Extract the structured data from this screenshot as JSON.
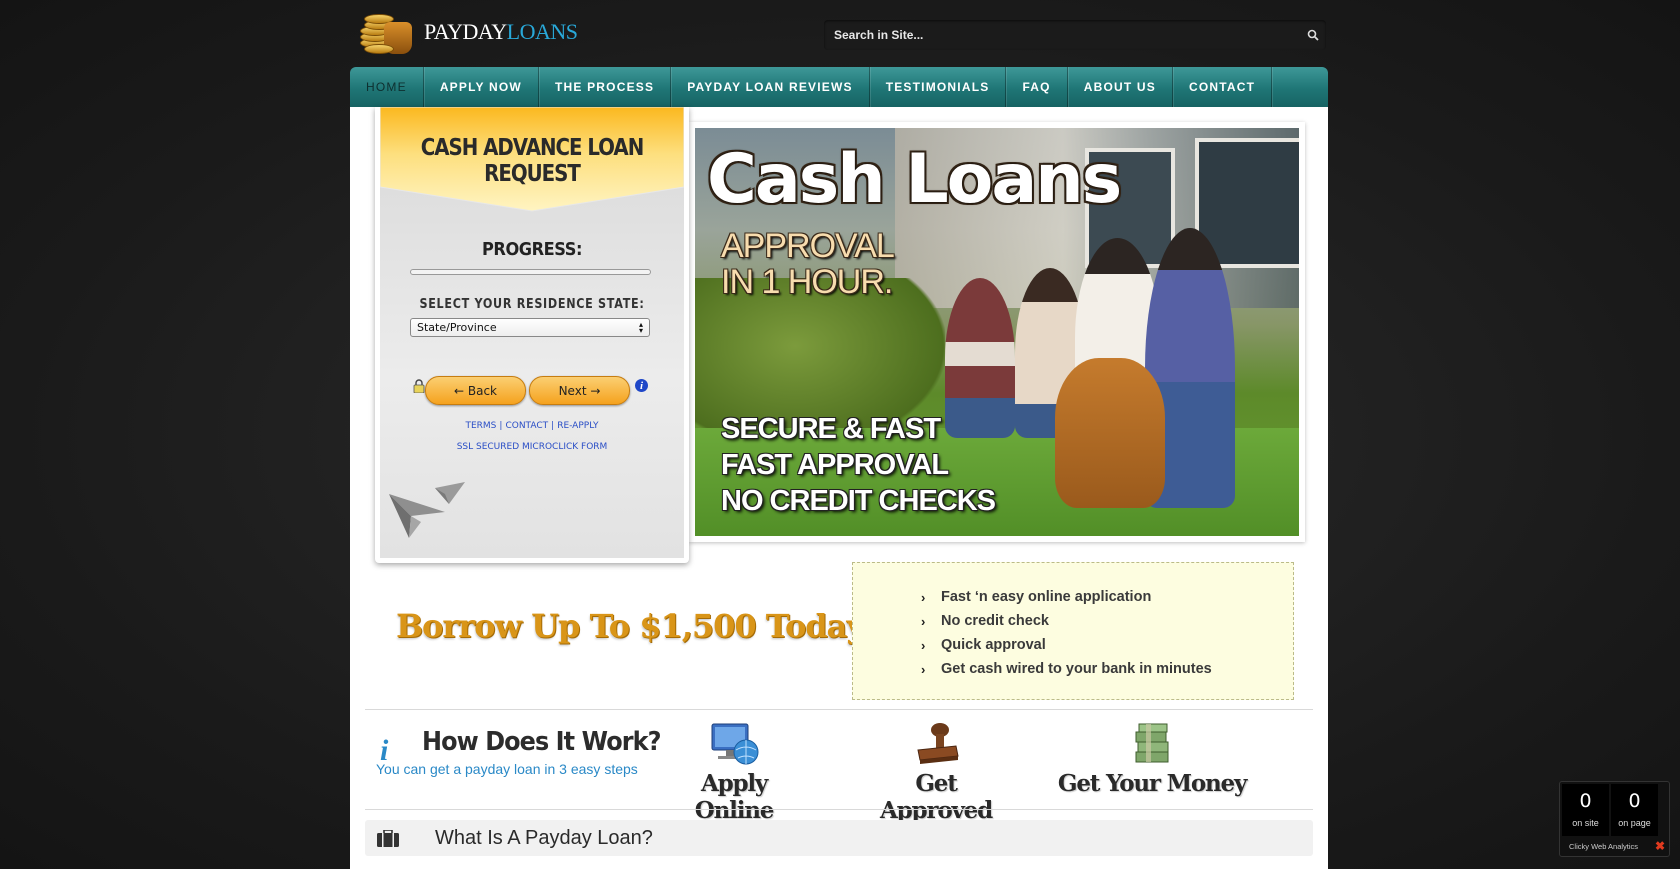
{
  "header": {
    "logo_word1": "PAYDAY",
    "logo_word2": "LOANS",
    "search_placeholder": "Search in Site..."
  },
  "nav": [
    {
      "label": "HOME",
      "active": true
    },
    {
      "label": "APPLY NOW"
    },
    {
      "label": "THE PROCESS"
    },
    {
      "label": "PAYDAY LOAN REVIEWS"
    },
    {
      "label": "TESTIMONIALS"
    },
    {
      "label": "FAQ"
    },
    {
      "label": "ABOUT US"
    },
    {
      "label": "CONTACT"
    }
  ],
  "form": {
    "title": "CASH ADVANCE LOAN REQUEST",
    "progress_label": "PROGRESS:",
    "progress_value": 0,
    "state_label": "SELECT YOUR RESIDENCE STATE:",
    "state_value": "State/Province",
    "back_label": "← Back",
    "next_label": "Next →",
    "link_terms": "TERMS",
    "link_contact": "CONTACT",
    "link_reapply": "RE-APPLY",
    "ssl_text": "SSL SECURED MICROCLICK FORM"
  },
  "hero": {
    "title": "Cash Loans",
    "sub_line1": "APPROVAL",
    "sub_line2": "IN 1 HOUR.",
    "bullets": [
      "SECURE & FAST",
      "FAST APPROVAL",
      "NO CREDIT CHECKS"
    ]
  },
  "promo": {
    "borrow": "Borrow Up To $1,500 Today!",
    "features": [
      "Fast ‘n easy online application",
      "No credit check",
      "Quick approval",
      "Get cash wired to your bank in minutes"
    ]
  },
  "how": {
    "title": "How Does It Work?",
    "subtitle": "You can get a payday loan in 3 easy steps",
    "steps": [
      "Apply Online",
      "Get Approved",
      "Get Your Money"
    ]
  },
  "what": {
    "title": "What Is A Payday Loan?"
  },
  "clicky": {
    "on_site_count": "0",
    "on_site_label": "on site",
    "on_page_count": "0",
    "on_page_label": "on page",
    "footer": "Clicky Web Analytics"
  },
  "colors": {
    "nav": "#1f7676",
    "accent_blue": "#29a8d8",
    "orange": "#f5a21e",
    "borrow": "#d99518"
  }
}
